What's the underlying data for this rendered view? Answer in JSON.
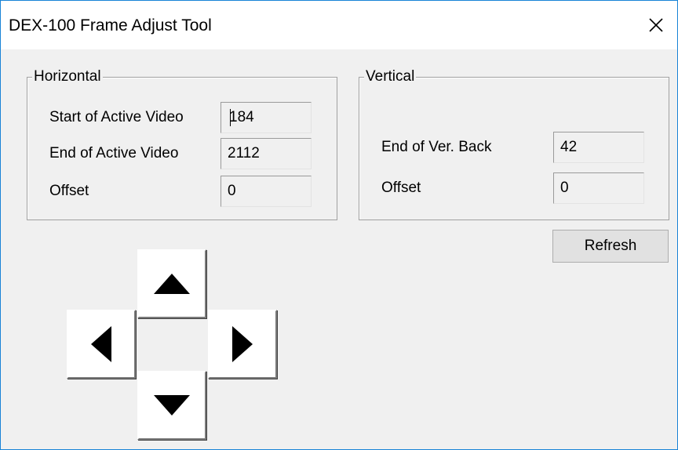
{
  "window": {
    "title": "DEX-100 Frame Adjust Tool",
    "close_icon": "close-icon"
  },
  "horizontal": {
    "legend": "Horizontal",
    "start_label": "Start of Active Video",
    "start_value": "184",
    "end_label": "End of Active Video",
    "end_value": "2112",
    "offset_label": "Offset",
    "offset_value": "0"
  },
  "vertical": {
    "legend": "Vertical",
    "end_back_label": "End of Ver. Back",
    "end_back_value": "42",
    "offset_label": "Offset",
    "offset_value": "0"
  },
  "buttons": {
    "refresh_label": "Refresh"
  },
  "arrows": {
    "up": "arrow-up-icon",
    "down": "arrow-down-icon",
    "left": "arrow-left-icon",
    "right": "arrow-right-icon"
  },
  "colors": {
    "window_border": "#1883d7",
    "dialog_bg": "#f0f0f0",
    "arrow_fill": "#000000"
  }
}
